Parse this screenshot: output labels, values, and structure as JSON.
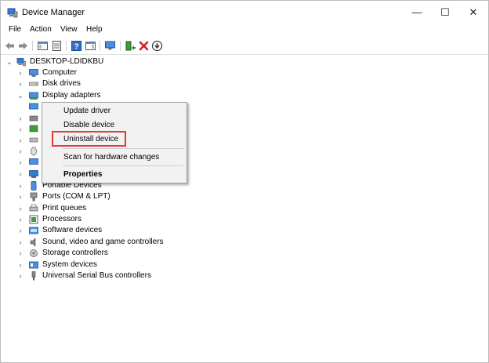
{
  "window": {
    "title": "Device Manager",
    "controls": {
      "minimize": "—",
      "maximize": "☐",
      "close": "✕"
    }
  },
  "menu": [
    "File",
    "Action",
    "View",
    "Help"
  ],
  "tree": {
    "root": "DESKTOP-LDIDKBU",
    "items": [
      {
        "label": "Computer"
      },
      {
        "label": "Disk drives"
      },
      {
        "label": "Display adapters"
      },
      {
        "label": "Portable Devices"
      },
      {
        "label": "Ports (COM & LPT)"
      },
      {
        "label": "Print queues"
      },
      {
        "label": "Processors"
      },
      {
        "label": "Software devices"
      },
      {
        "label": "Sound, video and game controllers"
      },
      {
        "label": "Storage controllers"
      },
      {
        "label": "System devices"
      },
      {
        "label": "Universal Serial Bus controllers"
      }
    ]
  },
  "context_menu": {
    "items": [
      "Update driver",
      "Disable device",
      "Uninstall device",
      "Scan for hardware changes",
      "Properties"
    ],
    "highlighted": "Uninstall device"
  },
  "colors": {
    "highlight_box": "#e53935",
    "remove": "#d42020",
    "icon_blue": "#2f7fd1"
  }
}
